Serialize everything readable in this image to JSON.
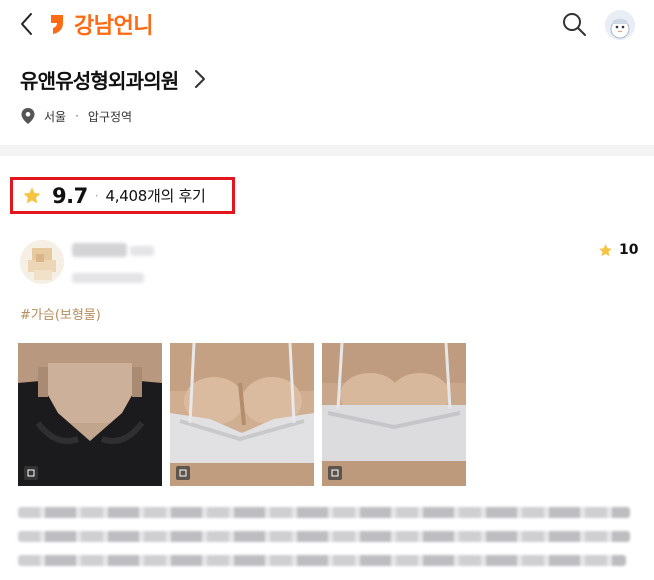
{
  "header": {
    "logo_text": "강남언니",
    "brand_color": "#ff6a14",
    "back_icon": "chevron-left-icon",
    "search_icon": "search-icon",
    "profile_icon": "avatar-icon"
  },
  "clinic": {
    "name": "유앤유성형외과의원",
    "region": "서울",
    "area": "압구정역",
    "separator": "·"
  },
  "rating": {
    "score": "9.7",
    "separator": "·",
    "review_count": "4,408개의 후기",
    "star_color": "#f6c443",
    "highlight_color": "#e4161d"
  },
  "review": {
    "score": "10",
    "tag": "#가슴(보형물)",
    "photo_count": 3
  }
}
